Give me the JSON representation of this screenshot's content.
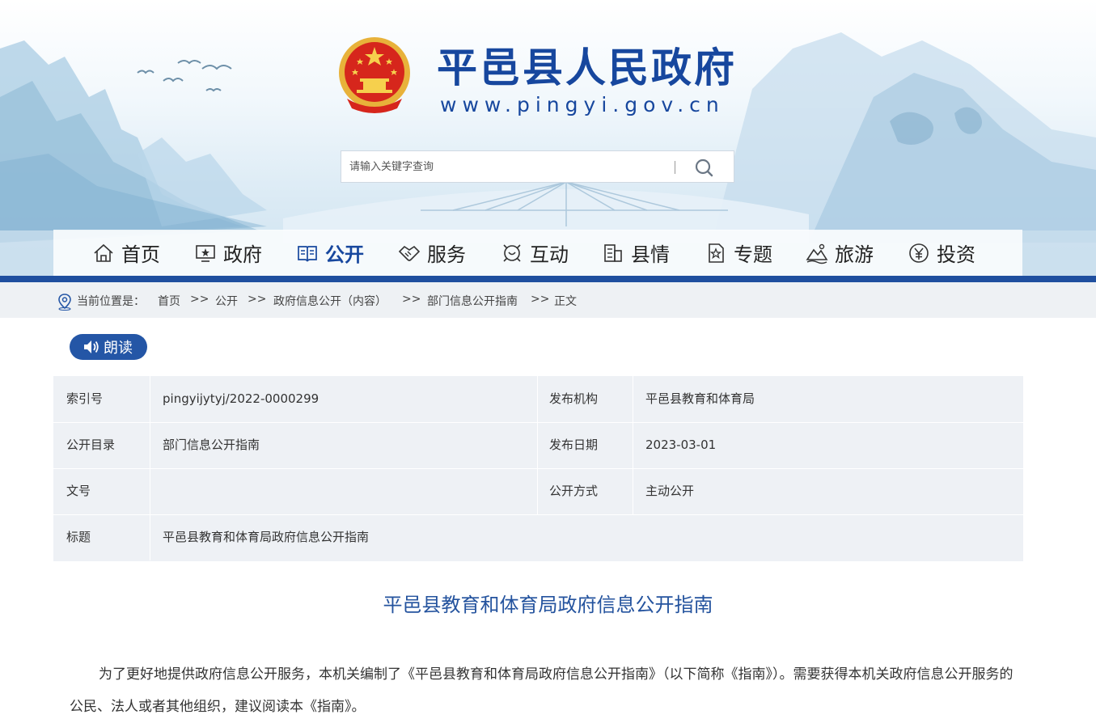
{
  "header": {
    "site_title": "平邑县人民政府",
    "site_url": "www.pingyi.gov.cn",
    "emblem_icon": "national-emblem-icon",
    "brand_color": "#17479e"
  },
  "search": {
    "placeholder": "请输入关键字查询",
    "value": "",
    "button_icon": "search-icon"
  },
  "nav": {
    "active_index": 2,
    "items": [
      {
        "label": "首页",
        "icon": "home-icon"
      },
      {
        "label": "政府",
        "icon": "monitor-icon"
      },
      {
        "label": "公开",
        "icon": "book-icon"
      },
      {
        "label": "服务",
        "icon": "handshake-icon"
      },
      {
        "label": "互动",
        "icon": "interaction-icon"
      },
      {
        "label": "县情",
        "icon": "building-icon"
      },
      {
        "label": "专题",
        "icon": "star-doc-icon"
      },
      {
        "label": "旅游",
        "icon": "mountain-icon"
      },
      {
        "label": "投资",
        "icon": "yen-icon"
      }
    ]
  },
  "breadcrumb": {
    "prefix": "当前位置是：",
    "items": [
      "首页",
      "公开",
      "政府信息公开（内容）",
      "部门信息公开指南",
      "正文"
    ],
    "separator": ">>"
  },
  "read_button": {
    "label": "朗读",
    "icon": "speaker-icon"
  },
  "meta": {
    "index_label": "索引号",
    "index_value": "pingyijytyj/2022-0000299",
    "publisher_label": "发布机构",
    "publisher_value": "平邑县教育和体育局",
    "catalog_label": "公开目录",
    "catalog_value": "部门信息公开指南",
    "date_label": "发布日期",
    "date_value": "2023-03-01",
    "docno_label": "文号",
    "docno_value": "",
    "method_label": "公开方式",
    "method_value": "主动公开",
    "title_label": "标题",
    "title_value": "平邑县教育和体育局政府信息公开指南"
  },
  "article": {
    "title": "平邑县教育和体育局政府信息公开指南",
    "paragraph": "为了更好地提供政府信息公开服务，本机关编制了《平邑县教育和体育局政府信息公开指南》（以下简称《指南》）。需要获得本机关政府信息公开服务的公民、法人或者其他组织，建议阅读本《指南》。"
  }
}
